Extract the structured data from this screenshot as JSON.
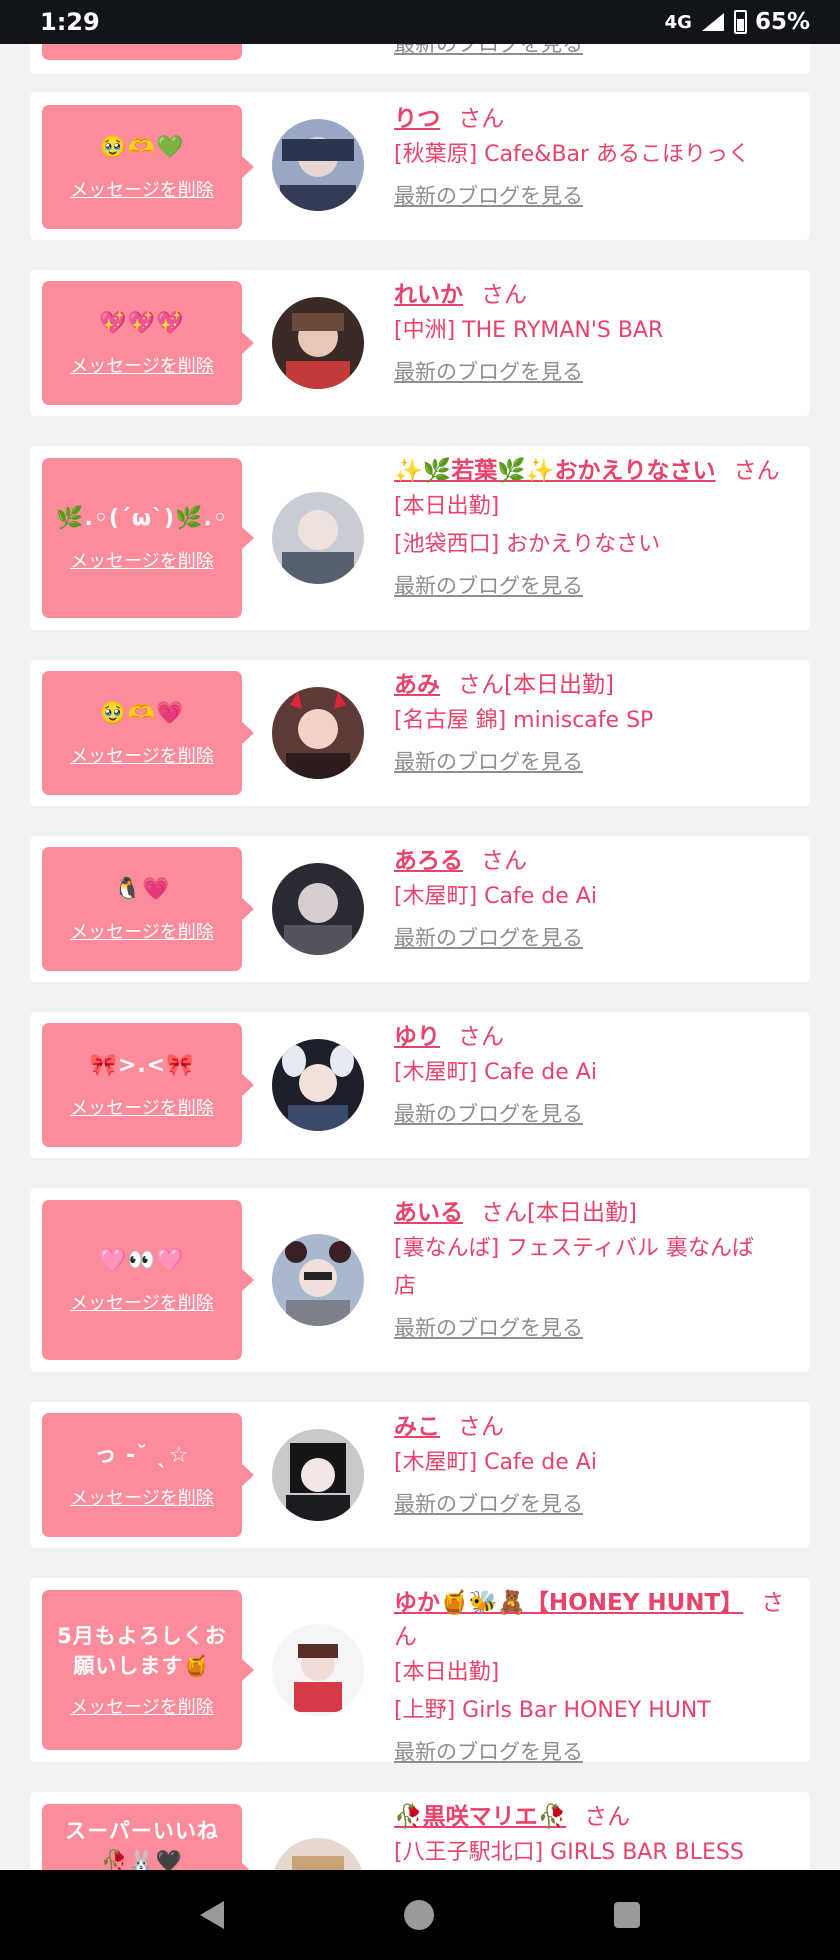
{
  "status": {
    "time": "1:29",
    "network": "4G",
    "battery": "65%"
  },
  "common": {
    "delete_label": "メッセージを削除",
    "blog_label": "最新のブログを見る",
    "san": "さん"
  },
  "cards": [
    {
      "message": "🥹🫶💚",
      "name": "りつ",
      "suffix": "",
      "lines": [
        "[秋葉原] Cafe&Bar あるこほりっく"
      ]
    },
    {
      "message": "💖💖💖",
      "name": "れいか",
      "suffix": "",
      "lines": [
        "[中洲] THE RYMAN'S BAR"
      ]
    },
    {
      "message": "🌿.◦(ˊωˋ)🌿.◦",
      "name": "✨🌿若葉🌿✨おかえりなさい",
      "suffix": "",
      "lines": [
        "[本日出勤]",
        "[池袋西口] おかえりなさい"
      ]
    },
    {
      "message": "🥹🫶💗",
      "name": "あみ",
      "suffix": "[本日出勤]",
      "lines": [
        "[名古屋 錦] miniscafe SP"
      ]
    },
    {
      "message": "🐧💗",
      "name": "あろる",
      "suffix": "",
      "lines": [
        "[木屋町] Cafe de Ai"
      ]
    },
    {
      "message": "🎀>.<🎀",
      "name": "ゆり",
      "suffix": "",
      "lines": [
        "[木屋町] Cafe de Ai"
      ]
    },
    {
      "message": "🩷👀🩷",
      "name": "あいる",
      "suffix": "[本日出勤]",
      "lines": [
        "[裏なんば] フェスティバル 裏なんば",
        "店"
      ]
    },
    {
      "message": "っ -˘ ˎ☆",
      "name": "みこ",
      "suffix": "",
      "lines": [
        "[木屋町] Cafe de Ai"
      ]
    },
    {
      "message": "5月もよろしくお願いします🍯",
      "name": "ゆか🍯🐝🧸【HONEY HUNT】",
      "suffix": "",
      "lines": [
        "[本日出勤]",
        "[上野] Girls Bar HONEY HUNT"
      ]
    },
    {
      "message": "スーパーいいね 🥀🐰🖤",
      "name": "🥀黒咲マリエ🥀",
      "suffix": "",
      "lines": [
        "[八王子駅北口] GIRLS BAR BLESS"
      ]
    }
  ]
}
